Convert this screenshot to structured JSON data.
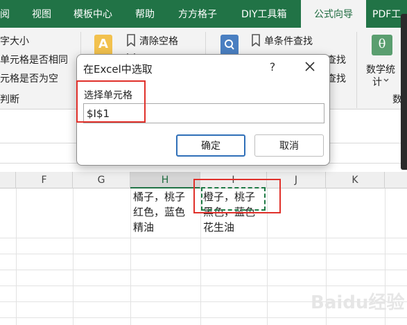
{
  "ribbon_tabs": [
    "阅",
    "视图",
    "模板中心",
    "帮助",
    "方方格子",
    "DIY工具箱",
    "公式向导",
    "PDF工"
  ],
  "active_tab_index": 6,
  "ribbon": {
    "left_items": [
      "字大小",
      "单元格是否相同",
      "元格是否为空",
      "判断"
    ],
    "clear_space_label": "清除空格",
    "single_condition_lookup_label": "单条件查找",
    "lookup_label_2": "查找",
    "lookup_label_3": "查找",
    "math_stats_line1": "数学统",
    "math_stats_line2": "计",
    "group_label_partial": "数",
    "icon_letter": "A",
    "theta_symbol": "θ"
  },
  "columns": [
    "F",
    "G",
    "H",
    "I",
    "J",
    "K"
  ],
  "selected_column": "H",
  "cells": {
    "H": [
      "橘子，桃子",
      "红色，蓝色",
      "精油"
    ],
    "I": [
      "橙子，桃子",
      "黑色，蓝色",
      "花生油"
    ]
  },
  "dialog": {
    "title": "在Excel中选取",
    "help": "?",
    "label": "选择单元格",
    "input_value": "$I$1",
    "ok": "确定",
    "cancel": "取消"
  },
  "watermark": "Baidu经验",
  "colors": {
    "ribbon_green": "#217346",
    "annotation_red": "#e0302a",
    "button_focus_blue": "#2f6fb8"
  }
}
